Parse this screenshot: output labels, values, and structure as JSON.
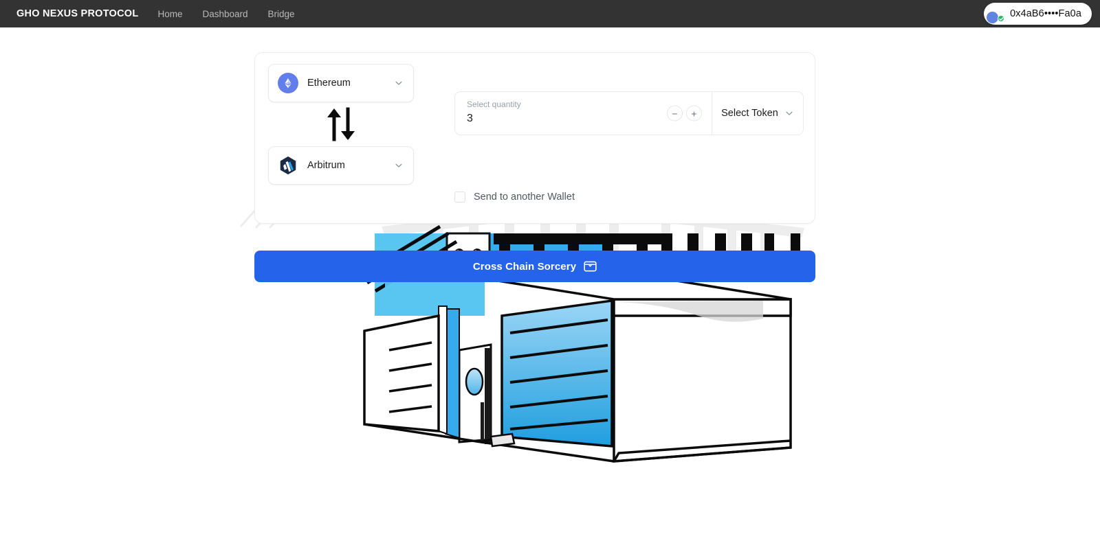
{
  "navbar": {
    "brand": "GHO NEXUS PROTOCOL",
    "links": [
      {
        "label": "Home"
      },
      {
        "label": "Dashboard"
      },
      {
        "label": "Bridge"
      }
    ],
    "wallet": {
      "address": "0x4aB6••••Fa0a",
      "avatar_icon": "wallet-avatar-icon",
      "status_icon": "green-check-badge-icon",
      "status_color": "#29b765"
    },
    "background_color": "#333333",
    "link_color": "#b9b9b9"
  },
  "bridge": {
    "from_chain": {
      "name": "Ethereum",
      "icon": "ethereum-icon",
      "icon_color": "#627EEA",
      "chevron_icon": "chevron-down-icon"
    },
    "to_chain": {
      "name": "Arbitrum",
      "icon": "arbitrum-icon",
      "icon_color": "#1B2B45",
      "chevron_icon": "chevron-down-icon"
    },
    "swap_icon": "swap-vertical-arrows-icon",
    "quantity": {
      "caption": "Select quantity",
      "value": "3",
      "decrement_label": "−",
      "increment_label": "+",
      "decrement_icon": "minus-icon",
      "increment_icon": "plus-icon"
    },
    "token": {
      "label": "Select Token",
      "chevron_icon": "chevron-down-icon"
    },
    "send_another_wallet": {
      "label": "Send to another Wallet",
      "checked": false
    }
  },
  "cta": {
    "label": "Cross Chain Sorcery",
    "icon": "wallet-icon",
    "color": "#2563eb"
  },
  "illustration": {
    "name": "house-garage-line-art-illustration",
    "accent_blue": "#35aaec",
    "light_blue": "#6cc9f2"
  }
}
